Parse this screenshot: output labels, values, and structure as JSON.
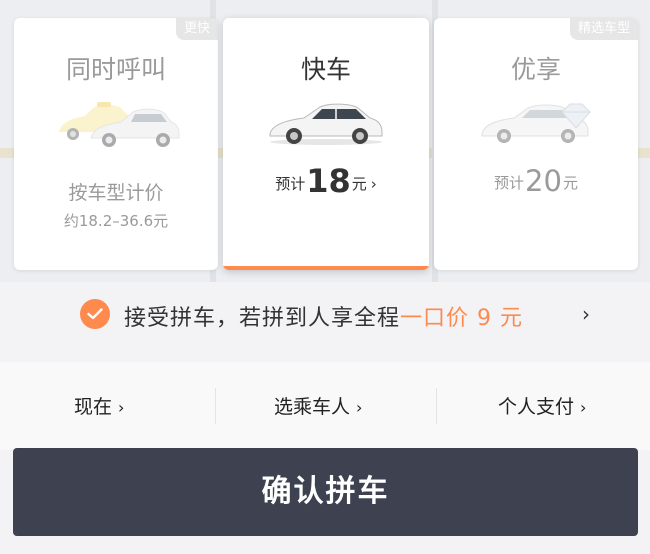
{
  "cards": [
    {
      "title": "同时呼叫",
      "tag": "更快",
      "pricing_note": "按车型计价",
      "range": "约18.2–36.6元",
      "selected": false,
      "icon": "taxi-and-car-icon"
    },
    {
      "title": "快车",
      "price_prefix": "预计",
      "price": "18",
      "price_unit": "元",
      "chevron": "›",
      "selected": true,
      "icon": "car-icon"
    },
    {
      "title": "优享",
      "tag": "精选车型",
      "price_prefix": "预计",
      "price": "20",
      "price_unit": "元",
      "selected": false,
      "icon": "premium-car-diamond-icon"
    }
  ],
  "carpool": {
    "checked": true,
    "text": "接受拼车，若拼到人享全程",
    "price_text": "一口价 9 元",
    "chevron": "›"
  },
  "options": [
    {
      "label": "现在",
      "chevron": "›"
    },
    {
      "label": "选乘车人",
      "chevron": "›"
    },
    {
      "label": "个人支付",
      "chevron": "›"
    }
  ],
  "confirm_label": "确认拼车",
  "colors": {
    "accent": "#ff8a4d",
    "button": "#3d4150"
  }
}
